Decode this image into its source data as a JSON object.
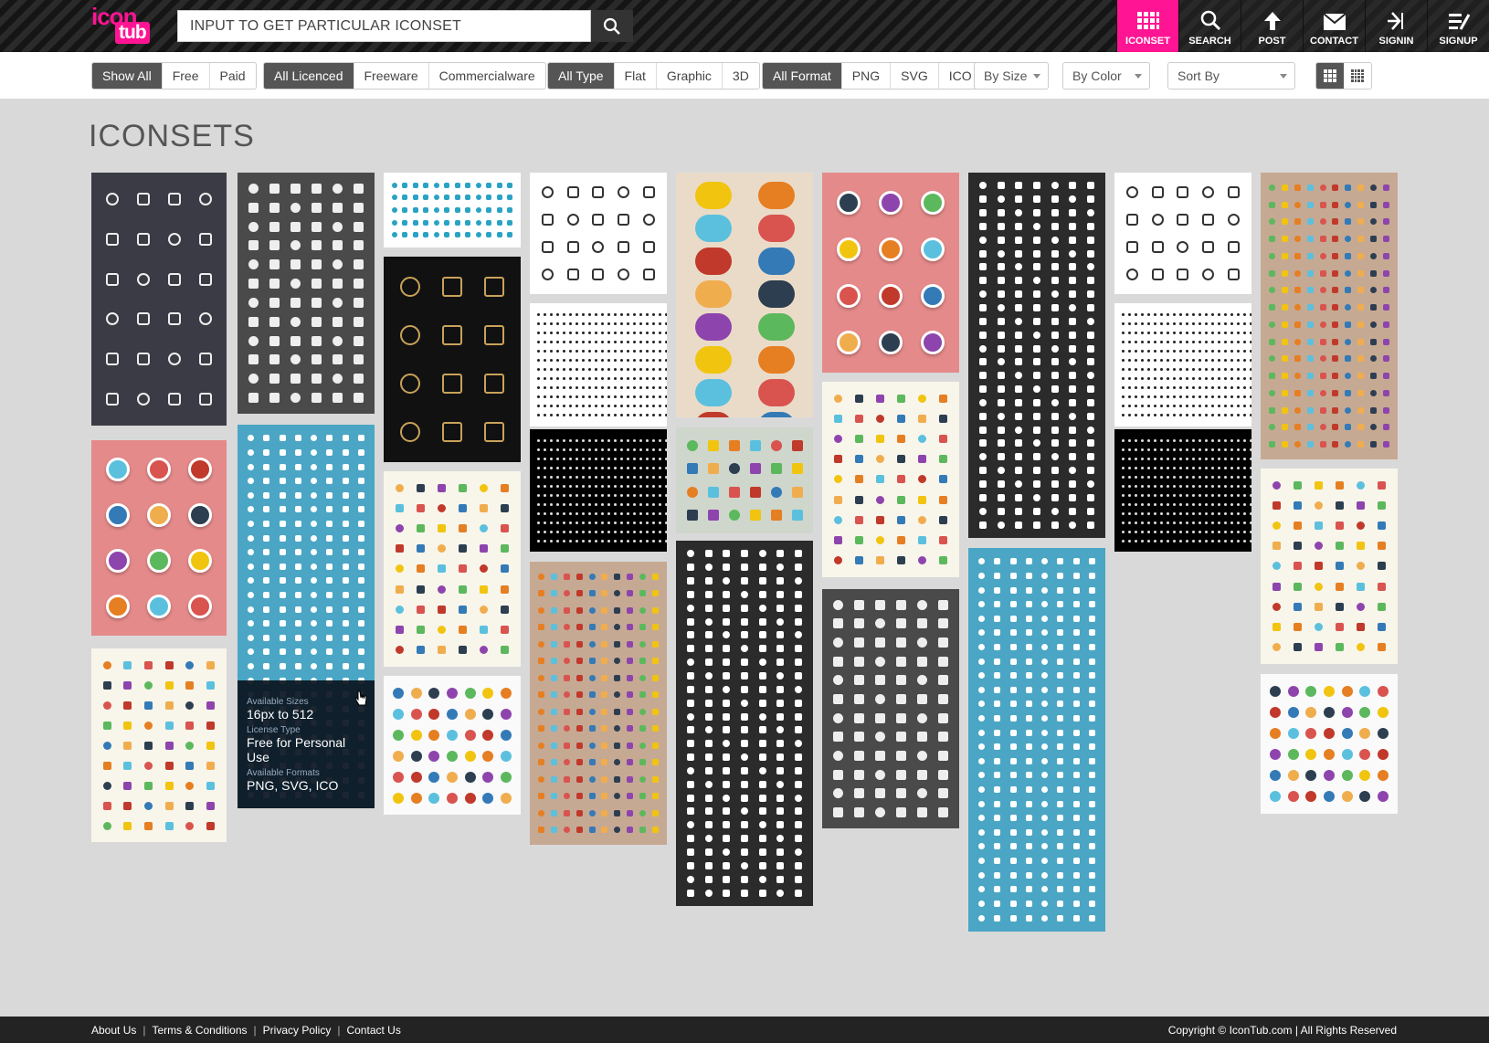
{
  "header": {
    "logo_top": "icon",
    "logo_bottom": "tub",
    "search_placeholder": "INPUT TO GET PARTICULAR ICONSET",
    "nav": [
      {
        "label": "ICONSET",
        "icon": "grid-icon"
      },
      {
        "label": "SEARCH",
        "icon": "search-icon"
      },
      {
        "label": "POST",
        "icon": "arrow-up-icon"
      },
      {
        "label": "CONTACT",
        "icon": "mail-icon"
      },
      {
        "label": "SIGNIN",
        "icon": "signin-icon"
      },
      {
        "label": "SIGNUP",
        "icon": "signup-icon"
      }
    ],
    "accent": "#ff1493"
  },
  "filters": {
    "price": [
      "Show All",
      "Free",
      "Paid"
    ],
    "licence": [
      "All Licenced",
      "Freeware",
      "Commercialware"
    ],
    "type": [
      "All Type",
      "Flat",
      "Graphic",
      "3D"
    ],
    "format": [
      "All Format",
      "PNG",
      "SVG",
      "ICO"
    ],
    "by_size": "By Size",
    "by_color": "By Color",
    "sort_by": "Sort By"
  },
  "main": {
    "title": "ICONSETS",
    "hover_card": {
      "sizes_label": "Available Sizes",
      "sizes_value": "16px to 512",
      "license_label": "License Type",
      "license_value": "Free for Personal Use",
      "formats_label": "Available Formats",
      "formats_value": "PNG, SVG, ICO"
    }
  },
  "footer": {
    "links": [
      "About Us",
      "Terms & Conditions",
      "Privacy Policy",
      "Contact Us"
    ],
    "copyright": "Copyright © IconTub.com | All Rights Reserved"
  }
}
